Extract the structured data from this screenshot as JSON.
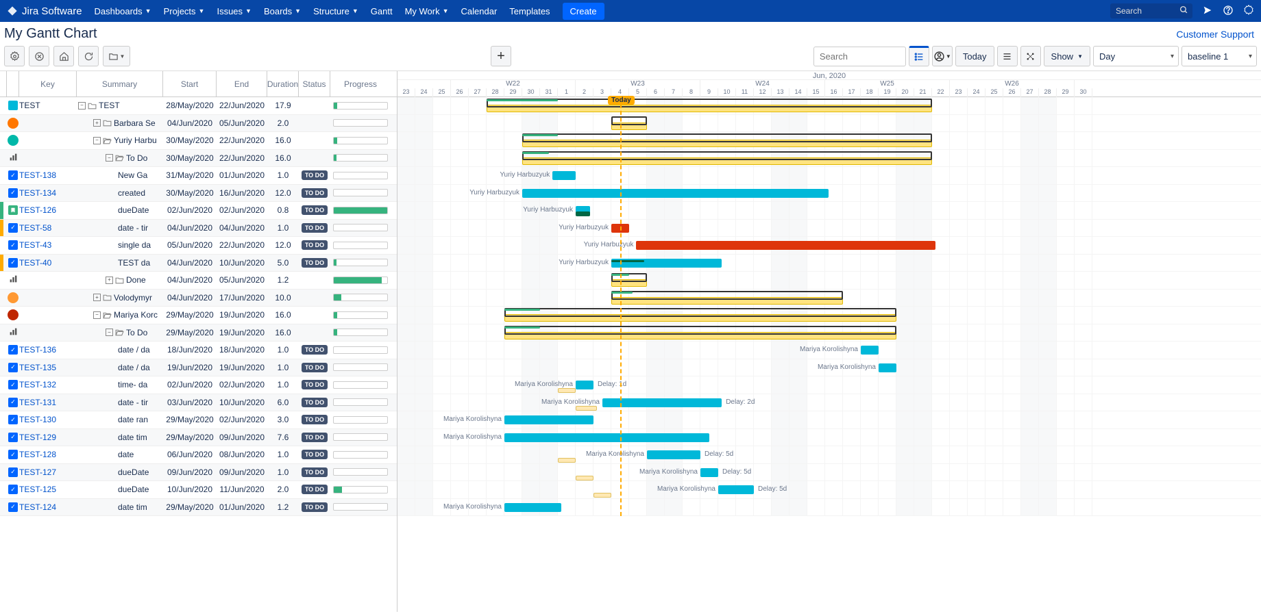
{
  "nav": {
    "product": "Jira Software",
    "items": [
      "Dashboards",
      "Projects",
      "Issues",
      "Boards",
      "Structure",
      "Gantt",
      "My Work",
      "Calendar",
      "Templates"
    ],
    "items_caret": [
      true,
      true,
      true,
      true,
      true,
      false,
      true,
      false,
      false
    ],
    "create": "Create",
    "search_placeholder": "Search"
  },
  "page": {
    "title": "My Gantt Chart",
    "support": "Customer Support"
  },
  "toolbar": {
    "search_placeholder": "Search",
    "today": "Today",
    "show": "Show",
    "zoom": "Day",
    "baseline": "baseline 1"
  },
  "columns": [
    "Key",
    "Summary",
    "Start",
    "End",
    "Duration",
    "Status",
    "Progress"
  ],
  "timeline": {
    "month": "Jun, 2020",
    "weeks": [
      {
        "label": "W22",
        "span": 7
      },
      {
        "label": "W23",
        "span": 7
      },
      {
        "label": "W24",
        "span": 7
      },
      {
        "label": "W25",
        "span": 7
      },
      {
        "label": "W26",
        "span": 7
      }
    ],
    "days": [
      "23",
      "24",
      "25",
      "26",
      "27",
      "28",
      "29",
      "30",
      "31",
      "1",
      "2",
      "3",
      "4",
      "5",
      "6",
      "7",
      "8",
      "9",
      "10",
      "11",
      "12",
      "13",
      "14",
      "15",
      "16",
      "17",
      "18",
      "19",
      "20",
      "21",
      "22",
      "23",
      "24",
      "25",
      "26",
      "27",
      "28",
      "29",
      "30"
    ],
    "weekend_idx": [
      0,
      1,
      7,
      8,
      14,
      15,
      21,
      22,
      28,
      29,
      35,
      36
    ],
    "today_idx": 12,
    "today_label": "Today",
    "start_day_offset": 0
  },
  "rows": [
    {
      "icon": "proj",
      "key": "TEST",
      "key_color": "#172b4d",
      "sumIndent": 0,
      "expander": "-",
      "sumIcon": "folder",
      "summary": "TEST",
      "start": "28/May/2020",
      "end": "22/Jun/2020",
      "dur": "17.9",
      "status": "",
      "progress": 6,
      "marker": "",
      "bar": {
        "type": "summary",
        "from": 5,
        "to": 30,
        "progFrom": 5,
        "progTo": 9
      }
    },
    {
      "icon": "avatar-orange",
      "key": "",
      "sumIndent": 22,
      "expander": "+",
      "sumIcon": "folder-closed",
      "summary": "Barbara Se",
      "start": "04/Jun/2020",
      "end": "05/Jun/2020",
      "dur": "2.0",
      "status": "",
      "progress": 0,
      "bar": {
        "type": "summary",
        "from": 12,
        "to": 14,
        "progFrom": 12,
        "progTo": 12
      }
    },
    {
      "icon": "avatar-teal",
      "key": "",
      "sumIndent": 22,
      "expander": "-",
      "sumIcon": "folder-open",
      "summary": "Yuriy Harbu",
      "start": "30/May/2020",
      "end": "22/Jun/2020",
      "dur": "16.0",
      "status": "",
      "progress": 7,
      "bar": {
        "type": "summary",
        "from": 7,
        "to": 30,
        "progFrom": 7,
        "progTo": 9
      }
    },
    {
      "icon": "poll",
      "key": "",
      "sumIndent": 40,
      "expander": "-",
      "sumIcon": "folder-open",
      "summary": "To Do",
      "start": "30/May/2020",
      "end": "22/Jun/2020",
      "dur": "16.0",
      "status": "",
      "progress": 5,
      "bar": {
        "type": "summary",
        "from": 7,
        "to": 30,
        "progFrom": 7,
        "progTo": 8.5
      }
    },
    {
      "icon": "task",
      "key": "TEST-138",
      "sumIndent": 58,
      "summary": "New Ga",
      "start": "31/May/2020",
      "end": "01/Jun/2020",
      "dur": "1.0",
      "status": "TO DO",
      "progress": 0,
      "bar": {
        "type": "task",
        "from": 8.7,
        "to": 10,
        "label": "Yuriy Harbuzyuk",
        "labelSide": "left"
      }
    },
    {
      "icon": "task",
      "key": "TEST-134",
      "sumIndent": 58,
      "summary": "created",
      "start": "30/May/2020",
      "end": "16/Jun/2020",
      "dur": "12.0",
      "status": "TO DO",
      "progress": 0,
      "bar": {
        "type": "task",
        "from": 7,
        "to": 24.2,
        "label": "Yuriy Harbuzyuk",
        "labelSide": "left"
      }
    },
    {
      "icon": "story",
      "key": "TEST-126",
      "marker": "#36b37e",
      "sumIndent": 58,
      "summary": "dueDate",
      "start": "02/Jun/2020",
      "end": "02/Jun/2020",
      "dur": "0.8",
      "status": "TO DO",
      "progress": 100,
      "bar": {
        "type": "task",
        "from": 10,
        "to": 10.8,
        "label": "Yuriy Harbuzyuk",
        "labelSide": "left",
        "stacked": true
      }
    },
    {
      "icon": "task",
      "key": "TEST-58",
      "marker": "#ffab00",
      "sumIndent": 58,
      "summary": "date - tir",
      "start": "04/Jun/2020",
      "end": "04/Jun/2020",
      "dur": "1.0",
      "status": "TO DO",
      "progress": 0,
      "bar": {
        "type": "task",
        "from": 12,
        "to": 13,
        "red": true,
        "label": "Yuriy Harbuzyuk",
        "labelSide": "left",
        "depTo": true
      }
    },
    {
      "icon": "task",
      "key": "TEST-43",
      "sumIndent": 58,
      "summary": "single da",
      "start": "05/Jun/2020",
      "end": "22/Jun/2020",
      "dur": "12.0",
      "status": "TO DO",
      "progress": 0,
      "bar": {
        "type": "task",
        "from": 13.4,
        "to": 30.2,
        "red": true,
        "label": "Yuriy Harbuzyuk",
        "labelSide": "left",
        "depFrom": true
      }
    },
    {
      "icon": "task",
      "key": "TEST-40",
      "marker": "#ffab00",
      "sumIndent": 58,
      "summary": "TEST da",
      "start": "04/Jun/2020",
      "end": "10/Jun/2020",
      "dur": "5.0",
      "status": "TO DO",
      "progress": 5,
      "bar": {
        "type": "task",
        "from": 12,
        "to": 18.2,
        "label": "Yuriy Harbuzyuk",
        "labelSide": "left",
        "subprog": 0.3
      }
    },
    {
      "icon": "poll",
      "key": "",
      "sumIndent": 40,
      "expander": "+",
      "sumIcon": "folder-closed",
      "summary": "Done",
      "start": "04/Jun/2020",
      "end": "05/Jun/2020",
      "dur": "1.2",
      "status": "",
      "progress": 90,
      "bar": {
        "type": "summary",
        "from": 12,
        "to": 14,
        "progFrom": 12,
        "progTo": 13
      }
    },
    {
      "icon": "avatar-orange2",
      "key": "",
      "sumIndent": 22,
      "expander": "+",
      "sumIcon": "folder-closed",
      "summary": "Volodymyr",
      "start": "04/Jun/2020",
      "end": "17/Jun/2020",
      "dur": "10.0",
      "status": "",
      "progress": 14,
      "bar": {
        "type": "summary",
        "from": 12,
        "to": 25,
        "progFrom": 12,
        "progTo": 13.2
      }
    },
    {
      "icon": "avatar-red",
      "key": "",
      "sumIndent": 22,
      "expander": "-",
      "sumIcon": "folder-open",
      "summary": "Mariya Korc",
      "start": "29/May/2020",
      "end": "19/Jun/2020",
      "dur": "16.0",
      "status": "",
      "progress": 7,
      "bar": {
        "type": "summary",
        "from": 6,
        "to": 28,
        "progFrom": 6,
        "progTo": 8
      }
    },
    {
      "icon": "poll",
      "key": "",
      "sumIndent": 40,
      "expander": "-",
      "sumIcon": "folder-open",
      "summary": "To Do",
      "start": "29/May/2020",
      "end": "19/Jun/2020",
      "dur": "16.0",
      "status": "",
      "progress": 7,
      "bar": {
        "type": "summary",
        "from": 6,
        "to": 28,
        "progFrom": 6,
        "progTo": 8
      }
    },
    {
      "icon": "task",
      "key": "TEST-136",
      "sumIndent": 58,
      "summary": "date / da",
      "start": "18/Jun/2020",
      "end": "18/Jun/2020",
      "dur": "1.0",
      "status": "TO DO",
      "progress": 0,
      "bar": {
        "type": "task",
        "from": 26,
        "to": 27,
        "label": "Mariya Korolishyna",
        "labelSide": "left",
        "depTo": true
      }
    },
    {
      "icon": "task",
      "key": "TEST-135",
      "sumIndent": 58,
      "summary": "date / da",
      "start": "19/Jun/2020",
      "end": "19/Jun/2020",
      "dur": "1.0",
      "status": "TO DO",
      "progress": 0,
      "bar": {
        "type": "task",
        "from": 27,
        "to": 28,
        "label": "Mariya Korolishyna",
        "labelSide": "left",
        "depFrom": true
      }
    },
    {
      "icon": "task",
      "key": "TEST-132",
      "sumIndent": 58,
      "summary": "time- da",
      "start": "02/Jun/2020",
      "end": "02/Jun/2020",
      "dur": "1.0",
      "status": "TO DO",
      "progress": 0,
      "bar": {
        "type": "task",
        "from": 10,
        "to": 11,
        "label": "Mariya Korolishyna",
        "labelSide": "left",
        "rightLabel": "Delay: 1d",
        "baseline": {
          "from": 9,
          "to": 10
        }
      }
    },
    {
      "icon": "task",
      "key": "TEST-131",
      "sumIndent": 58,
      "summary": "date - tir",
      "start": "03/Jun/2020",
      "end": "10/Jun/2020",
      "dur": "6.0",
      "status": "TO DO",
      "progress": 0,
      "bar": {
        "type": "task",
        "from": 11.5,
        "to": 18.2,
        "label": "Mariya Korolishyna",
        "labelSide": "left",
        "rightLabel": "Delay: 2d",
        "baseline": {
          "from": 10,
          "to": 11.2
        }
      }
    },
    {
      "icon": "task",
      "key": "TEST-130",
      "sumIndent": 58,
      "summary": "date ran",
      "start": "29/May/2020",
      "end": "02/Jun/2020",
      "dur": "3.0",
      "status": "TO DO",
      "progress": 0,
      "bar": {
        "type": "task",
        "from": 6,
        "to": 11,
        "label": "Mariya Korolishyna",
        "labelSide": "left"
      }
    },
    {
      "icon": "task",
      "key": "TEST-129",
      "sumIndent": 58,
      "summary": "date tim",
      "start": "29/May/2020",
      "end": "09/Jun/2020",
      "dur": "7.6",
      "status": "TO DO",
      "progress": 0,
      "bar": {
        "type": "task",
        "from": 6,
        "to": 17.5,
        "label": "Mariya Korolishyna",
        "labelSide": "left"
      }
    },
    {
      "icon": "task",
      "key": "TEST-128",
      "sumIndent": 58,
      "summary": "date",
      "start": "06/Jun/2020",
      "end": "08/Jun/2020",
      "dur": "1.0",
      "status": "TO DO",
      "progress": 0,
      "bar": {
        "type": "task",
        "from": 14,
        "to": 17,
        "label": "Mariya Korolishyna",
        "labelSide": "left",
        "rightLabel": "Delay: 5d",
        "baseline": {
          "from": 9,
          "to": 10
        }
      }
    },
    {
      "icon": "task",
      "key": "TEST-127",
      "sumIndent": 58,
      "summary": "dueDate",
      "start": "09/Jun/2020",
      "end": "09/Jun/2020",
      "dur": "1.0",
      "status": "TO DO",
      "progress": 0,
      "bar": {
        "type": "task",
        "from": 17,
        "to": 18,
        "label": "Mariya Korolishyna",
        "labelSide": "left",
        "rightLabel": "Delay: 5d",
        "baseline": {
          "from": 10,
          "to": 11
        }
      }
    },
    {
      "icon": "task",
      "key": "TEST-125",
      "sumIndent": 58,
      "summary": "dueDate",
      "start": "10/Jun/2020",
      "end": "11/Jun/2020",
      "dur": "2.0",
      "status": "TO DO",
      "progress": 15,
      "bar": {
        "type": "task",
        "from": 18,
        "to": 20,
        "label": "Mariya Korolishyna",
        "labelSide": "left",
        "rightLabel": "Delay: 5d",
        "baseline": {
          "from": 11,
          "to": 12
        }
      }
    },
    {
      "icon": "task",
      "key": "TEST-124",
      "sumIndent": 58,
      "summary": "date tim",
      "start": "29/May/2020",
      "end": "01/Jun/2020",
      "dur": "1.2",
      "status": "TO DO",
      "progress": 0,
      "bar": {
        "type": "task",
        "from": 6,
        "to": 9.2,
        "label": "Mariya Korolishyna",
        "labelSide": "left"
      }
    }
  ]
}
